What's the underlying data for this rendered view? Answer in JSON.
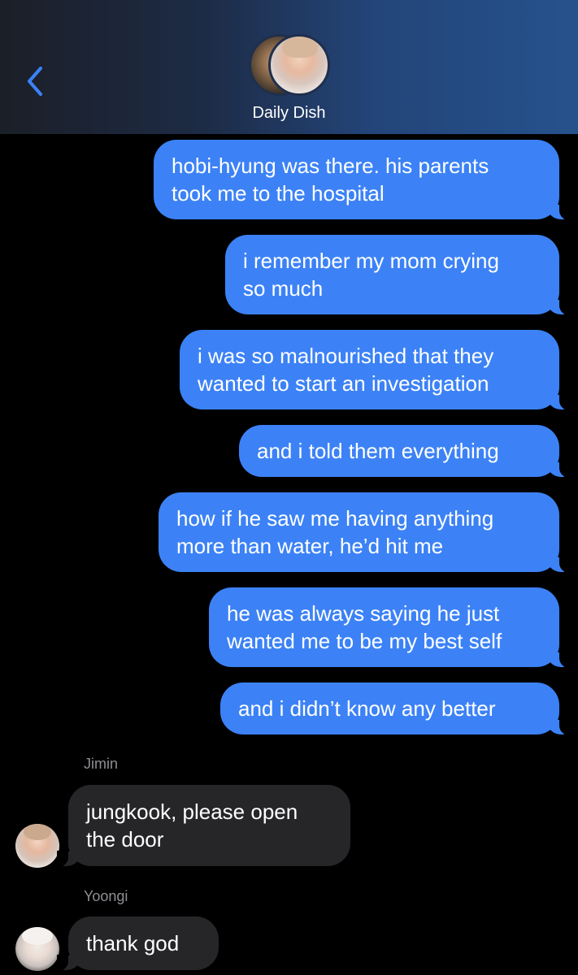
{
  "header": {
    "group_name": "Daily Dish"
  },
  "messages": {
    "m1": "hobi-hyung was there. his parents\ntook me to the hospital",
    "m2": "i remember my mom crying\nso much",
    "m3": "i was so malnourished that they\nwanted to start an investigation",
    "m4": "and i told them everything",
    "m5": "how if he saw me having anything\nmore than water, he’d hit me",
    "m6": "he was always saying he just\nwanted me to be my best self",
    "m7": "and i didn’t know any better",
    "jimin_name": "Jimin",
    "jimin_msg": "jungkook, please open\nthe door",
    "yoongi_name": "Yoongi",
    "yoongi_msg": "thank god"
  },
  "colors": {
    "outgoing_bubble": "#3c82f6",
    "incoming_bubble": "#262629",
    "accent": "#3b82f6"
  },
  "icons": {
    "back": "chevron-left-icon"
  }
}
